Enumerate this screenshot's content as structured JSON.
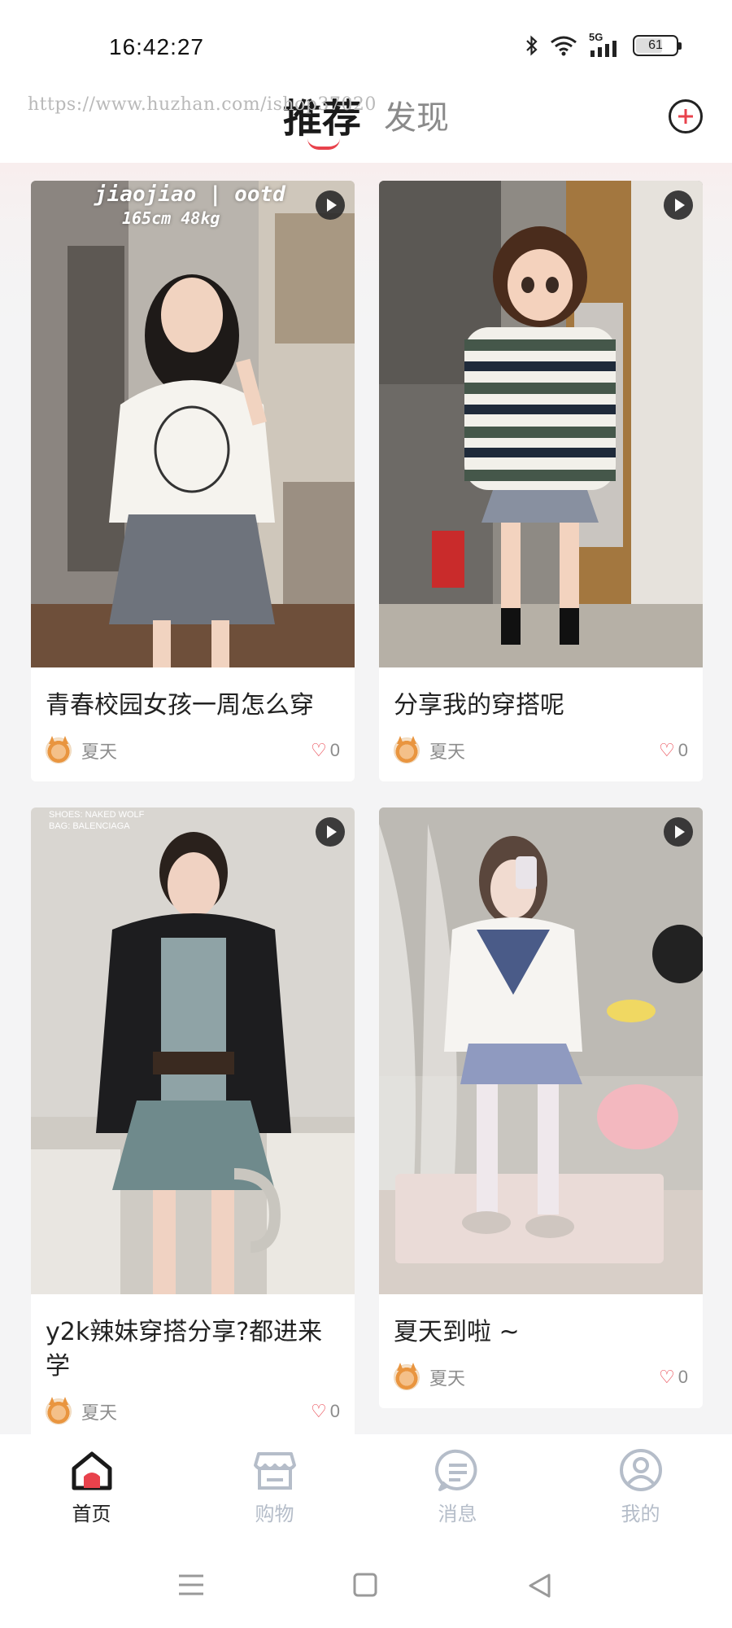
{
  "status_bar": {
    "time": "16:42:27",
    "network": "5G",
    "battery": "61"
  },
  "header": {
    "watermark": "https://www.huzhan.com/ishop37020",
    "tabs": [
      {
        "label": "推荐",
        "active": true
      },
      {
        "label": "发现",
        "active": false
      }
    ],
    "accent_color": "#e8424c"
  },
  "feed": {
    "cards": [
      {
        "title": "青春校园女孩一周怎么穿",
        "author": "夏天",
        "likes": "0",
        "overlay_line1": "jiaojiao | ootd",
        "overlay_line2": "165cm 48kg"
      },
      {
        "title": "分享我的穿搭呢",
        "author": "夏天",
        "likes": "0"
      },
      {
        "title": "y2k辣妹穿搭分享?都进来学",
        "author": "夏天",
        "likes": "0",
        "overlay_line1": "SHOES: NAKED WOLF",
        "overlay_line2": "BAG: BALENCIAGA"
      },
      {
        "title": "夏天到啦 ~",
        "author": "夏天",
        "likes": "0"
      }
    ]
  },
  "bottom_nav": {
    "items": [
      {
        "label": "首页",
        "icon": "home-icon",
        "active": true
      },
      {
        "label": "购物",
        "icon": "shop-icon",
        "active": false
      },
      {
        "label": "消息",
        "icon": "message-icon",
        "active": false
      },
      {
        "label": "我的",
        "icon": "profile-icon",
        "active": false
      }
    ]
  }
}
